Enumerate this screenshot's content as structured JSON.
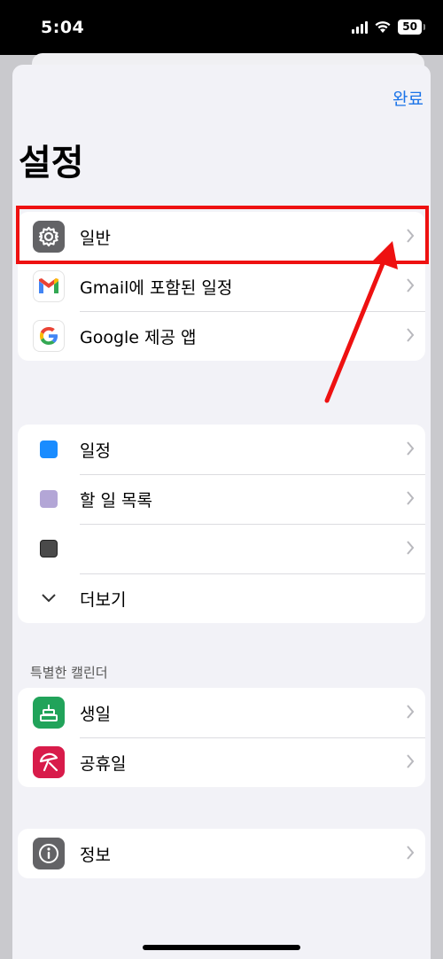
{
  "status_bar": {
    "time": "5:04",
    "battery": "50"
  },
  "nav": {
    "done_label": "완료"
  },
  "title": "설정",
  "group1": [
    {
      "label": "일반",
      "icon": "gear-icon"
    },
    {
      "label": "Gmail에 포함된 일정",
      "icon": "gmail-icon"
    },
    {
      "label": "Google 제공 앱",
      "icon": "google-icon"
    }
  ],
  "group2": [
    {
      "label": "일정",
      "color": "#1a8cff"
    },
    {
      "label": "할 일 목록",
      "color": "#b3a6d6"
    },
    {
      "label": "",
      "color": "#4a4a4a"
    },
    {
      "label": "더보기"
    }
  ],
  "special_header": "특별한 캘린더",
  "group3": [
    {
      "label": "생일",
      "icon": "birthday-cake-icon",
      "color": "#21a35a"
    },
    {
      "label": "공휴일",
      "icon": "holiday-umbrella-icon",
      "color": "#d81b4a"
    }
  ],
  "group4": [
    {
      "label": "정보",
      "icon": "info-icon"
    }
  ],
  "colors": {
    "accent": "#1a73e8",
    "highlight": "#ee1111"
  }
}
